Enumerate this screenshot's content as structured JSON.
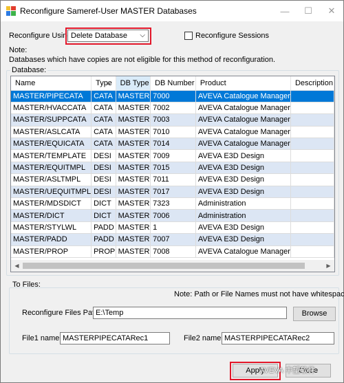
{
  "window": {
    "title": "Reconfigure Sameref-User MASTER Databases",
    "controls": {
      "minimize": "—",
      "maximize": "☐",
      "close": "✕"
    }
  },
  "reconfigure_using": {
    "label": "Reconfigure Using",
    "selected": "Delete Database",
    "options": [
      "Delete Database"
    ]
  },
  "reconfigure_sessions": {
    "label": "Reconfigure Sessions",
    "checked": false
  },
  "note": {
    "heading": "Note:",
    "text": "Databases which have copies are not eligible for this method of reconfiguration."
  },
  "database_group": {
    "label": "Database:",
    "columns": [
      "Name",
      "Type",
      "DB Type",
      "DB Number",
      "Product",
      "Description"
    ],
    "rows": [
      [
        "MASTER/PIPECATA",
        "CATA",
        "MASTER",
        "7000",
        "AVEVA Catalogue Manager",
        ""
      ],
      [
        "MASTER/HVACCATA",
        "CATA",
        "MASTER",
        "7002",
        "AVEVA Catalogue Manager",
        ""
      ],
      [
        "MASTER/SUPPCATA",
        "CATA",
        "MASTER",
        "7003",
        "AVEVA Catalogue Manager",
        ""
      ],
      [
        "MASTER/ASLCATA",
        "CATA",
        "MASTER",
        "7010",
        "AVEVA Catalogue Manager",
        ""
      ],
      [
        "MASTER/EQUICATA",
        "CATA",
        "MASTER",
        "7014",
        "AVEVA Catalogue Manager",
        ""
      ],
      [
        "MASTER/TEMPLATE",
        "DESI",
        "MASTER",
        "7009",
        "AVEVA E3D Design",
        ""
      ],
      [
        "MASTER/EQUITMPL",
        "DESI",
        "MASTER",
        "7015",
        "AVEVA E3D Design",
        ""
      ],
      [
        "MASTER/ASLTMPL",
        "DESI",
        "MASTER",
        "7011",
        "AVEVA E3D Design",
        ""
      ],
      [
        "MASTER/UEQUITMPL",
        "DESI",
        "MASTER",
        "7017",
        "AVEVA E3D Design",
        ""
      ],
      [
        "MASTER/MDSDICT",
        "DICT",
        "MASTER",
        "7323",
        "Administration",
        ""
      ],
      [
        "MASTER/DICT",
        "DICT",
        "MASTER",
        "7006",
        "Administration",
        ""
      ],
      [
        "MASTER/STYLWL",
        "PADD",
        "MASTER",
        "1",
        "AVEVA E3D Design",
        ""
      ],
      [
        "MASTER/PADD",
        "PADD",
        "MASTER",
        "7007",
        "AVEVA E3D Design",
        ""
      ],
      [
        "MASTER/PROP",
        "PROP",
        "MASTER",
        "7008",
        "AVEVA Catalogue Manager",
        ""
      ]
    ],
    "selected_row": 0,
    "sorted_column": 2
  },
  "to_files": {
    "label": "To Files:",
    "note": "Note: Path or File Names must not have whitespaces.",
    "path_label": "Reconfigure Files Path:",
    "path_value": "E:\\Temp",
    "browse_label": "Browse",
    "file1_label": "File1 name:",
    "file1_value": "MASTERPIPECATARec1",
    "file2_label": "File2 name:",
    "file2_value": "MASTERPIPECATARec2"
  },
  "footer": {
    "apply_label": "Apply",
    "close_label": "Close",
    "watermark": "AVEVA 中望软件"
  },
  "colors": {
    "highlight_red": "#e2172a",
    "selection_blue": "#0078d7",
    "alt_row": "#dce6f4"
  }
}
